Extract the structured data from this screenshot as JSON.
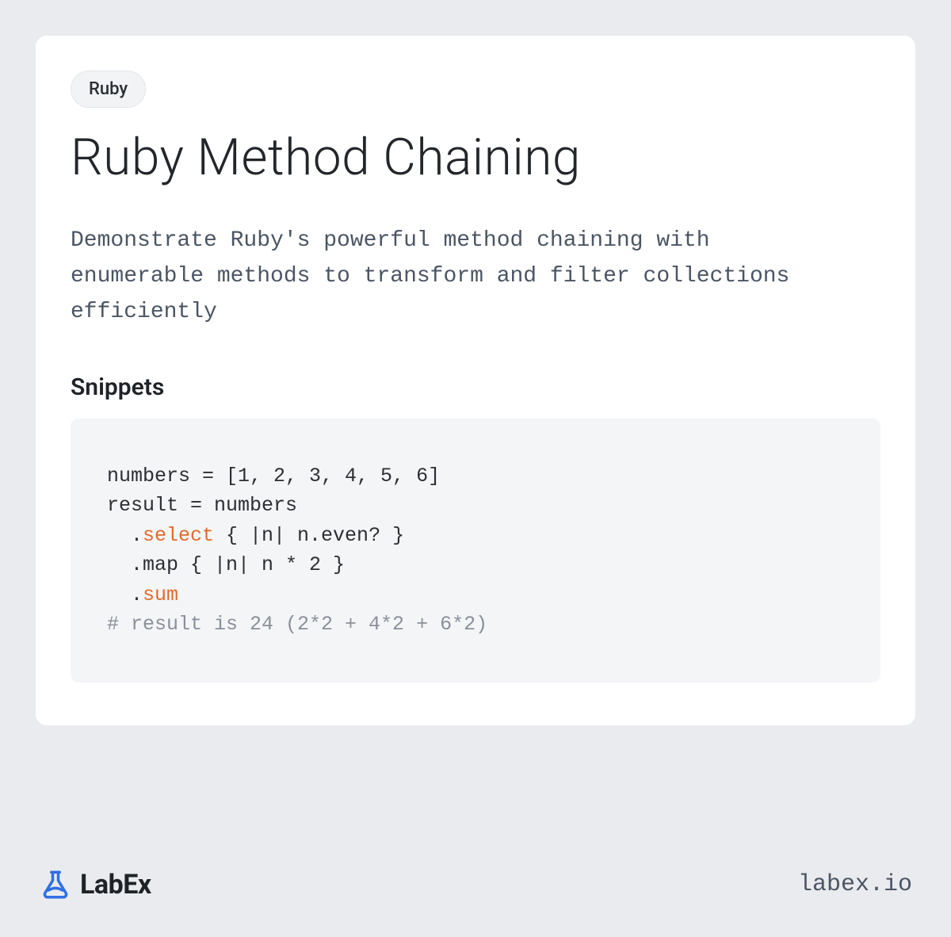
{
  "tag": "Ruby",
  "title": "Ruby Method Chaining",
  "description": "Demonstrate Ruby's powerful method chaining with enumerable methods to transform and filter collections efficiently",
  "section_heading": "Snippets",
  "code": {
    "line1": "numbers = [1, 2, 3, 4, 5, 6]",
    "line2": "result = numbers",
    "line3_pre": "  .",
    "line3_hl": "select",
    "line3_post": " { |n| n.even? }",
    "line4": "  .map { |n| n * 2 }",
    "line5_pre": "  .",
    "line5_hl": "sum",
    "comment": "# result is 24 (2*2 + 4*2 + 6*2)"
  },
  "brand": "LabEx",
  "site": "labex.io"
}
